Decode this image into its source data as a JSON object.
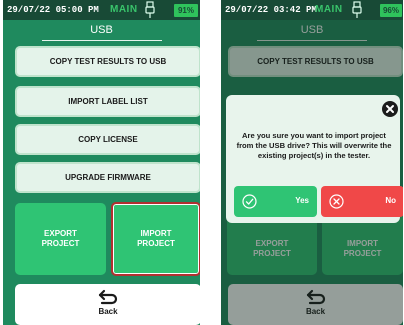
{
  "left": {
    "status": {
      "time": "29/07/22 05:00 PM",
      "mode": "MAIN",
      "battery": "91%"
    },
    "title": "USB",
    "buttons": {
      "copy_results": "COPY TEST RESULTS TO USB",
      "import_label": "IMPORT LABEL LIST",
      "copy_license": "COPY LICENSE",
      "upgrade_firmware": "UPGRADE FIRMWARE"
    },
    "export_project": {
      "line1": "EXPORT",
      "line2": "PROJECT"
    },
    "import_project": {
      "line1": "IMPORT",
      "line2": "PROJECT"
    },
    "back": "Back"
  },
  "right": {
    "status": {
      "time": "29/07/22 03:42 PM",
      "mode": "MAIN",
      "battery": "96%"
    },
    "title": "USB",
    "buttons": {
      "copy_results": "COPY TEST RESULTS TO USB"
    },
    "export_project": {
      "line1": "EXPORT",
      "line2": "PROJECT"
    },
    "import_project": {
      "line1": "IMPORT",
      "line2": "PROJECT"
    },
    "back": "Back",
    "dialog": {
      "message": "Are you sure you want to import project from the USB drive? This will overwrite the existing project(s) in the tester.",
      "yes_label": "Yes",
      "no_label": "No"
    }
  },
  "colors": {
    "background": "#1f8a5e",
    "status_bar": "#184a36",
    "accent_green": "#2fc474",
    "danger_red": "#f04848",
    "selected_border": "#b03030"
  },
  "icons": {
    "plug": "usb-plug-icon",
    "back": "return-arrow-icon",
    "close": "close-icon",
    "yes": "check-circle-icon",
    "no": "x-circle-icon"
  }
}
